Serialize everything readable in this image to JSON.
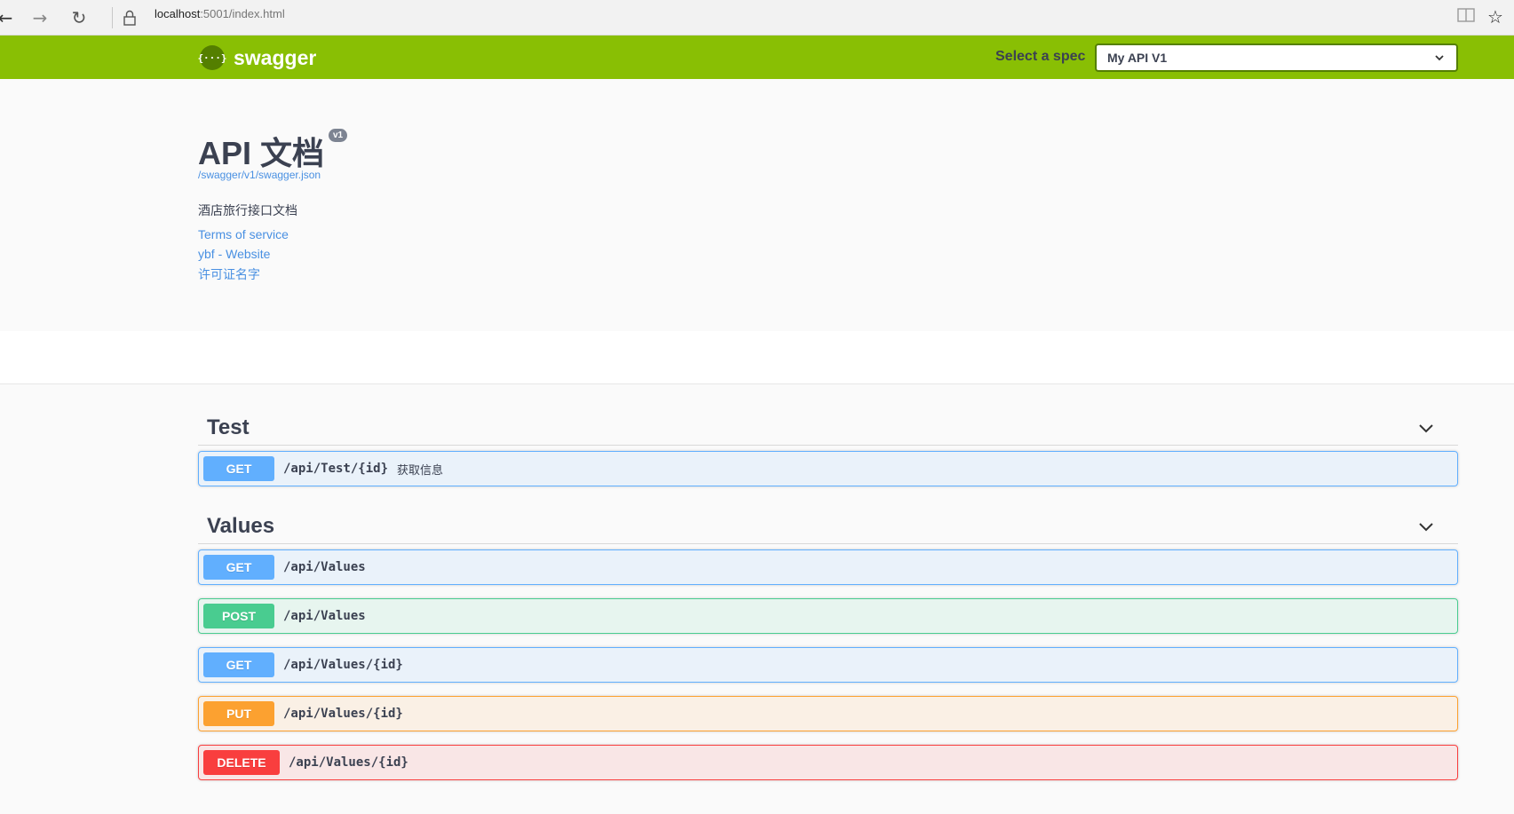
{
  "browser": {
    "url_host": "localhost",
    "url_rest": ":5001/index.html",
    "icons": {
      "back": "arrow-left-icon",
      "forward": "arrow-right-icon",
      "reload": "reload-icon",
      "lock": "lock-icon",
      "reading": "reading-view-icon",
      "favorite": "star-icon"
    }
  },
  "topbar": {
    "logo_mark": "{···}",
    "logo_text": "swagger",
    "spec_label": "Select a spec",
    "spec_selected": "My API V1",
    "color": "#89bf04"
  },
  "info": {
    "title": "API 文档",
    "version": "v1",
    "spec_url": "/swagger/v1/swagger.json",
    "description": "酒店旅行接口文档",
    "links": [
      "Terms of service",
      "ybf - Website",
      "许可证名字"
    ]
  },
  "groups": [
    {
      "name": "Test",
      "operations": [
        {
          "method": "GET",
          "path": "/api/Test/{id}",
          "summary": "获取信息"
        }
      ]
    },
    {
      "name": "Values",
      "operations": [
        {
          "method": "GET",
          "path": "/api/Values",
          "summary": ""
        },
        {
          "method": "POST",
          "path": "/api/Values",
          "summary": ""
        },
        {
          "method": "GET",
          "path": "/api/Values/{id}",
          "summary": ""
        },
        {
          "method": "PUT",
          "path": "/api/Values/{id}",
          "summary": ""
        },
        {
          "method": "DELETE",
          "path": "/api/Values/{id}",
          "summary": ""
        }
      ]
    }
  ],
  "method_colors": {
    "GET": "#61affe",
    "POST": "#49cc90",
    "PUT": "#fca130",
    "DELETE": "#f93e3e"
  }
}
